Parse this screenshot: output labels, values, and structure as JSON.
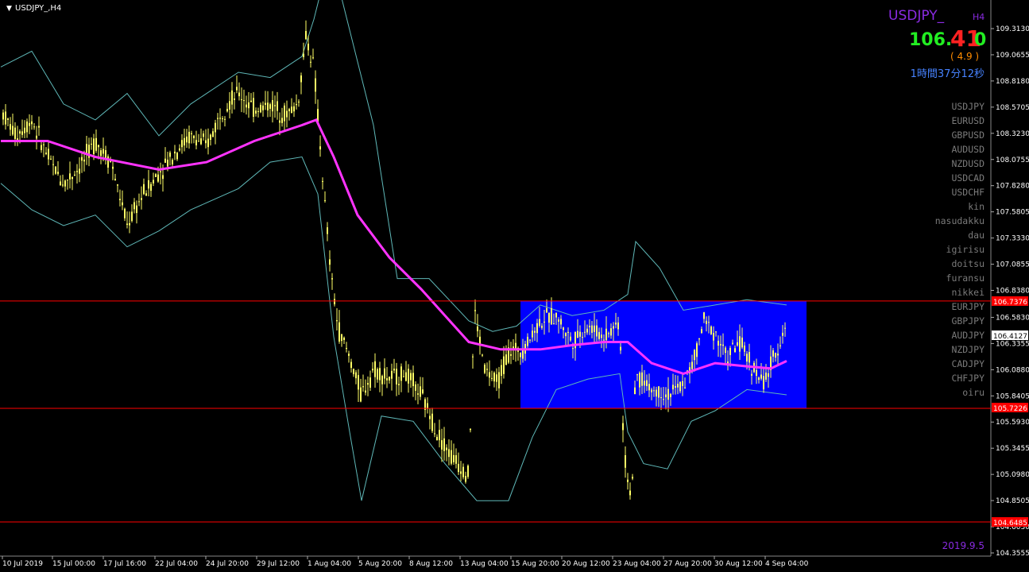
{
  "window": {
    "title": "USDJPY_,H4",
    "menu_glyph": "▼"
  },
  "info": {
    "symbol": "USDJPY_",
    "timeframe": "H4",
    "price_main": "106.",
    "price_big": "41",
    "price_last": "0",
    "spread": "( 4.9 )",
    "countdown": "1時間37分12秒",
    "date": "2019.9.5"
  },
  "symbol_list": [
    "USDJPY",
    "EURUSD",
    "GBPUSD",
    "AUDUSD",
    "NZDUSD",
    "USDCAD",
    "USDCHF",
    "kin",
    "nasudakku",
    "dau",
    "igirisu",
    "doitsu",
    "furansu",
    "nikkei",
    "EURJPY",
    "GBPJPY",
    "AUDJPY",
    "NZDJPY",
    "CADJPY",
    "CHFJPY",
    "oiru"
  ],
  "price_labels": {
    "upper_line": "106.7376",
    "current": "106.4127",
    "lower_line": "105.7226",
    "bottom_line": "104.6485"
  },
  "colors": {
    "background": "#000000",
    "candles": "#ffff66",
    "moving_average": "#ff33ff",
    "bollinger": "#5fb8b8",
    "range_box": "#0000ff",
    "hlines": "#ff0000",
    "symbol_title": "#8a2be2",
    "price_green": "#22ee22",
    "price_red": "#ff2222",
    "spread": "#ff8c00",
    "countdown": "#4682ff",
    "symbol_list": "#7a7a7a",
    "axis_text": "#ffffff"
  },
  "chart_data": {
    "type": "candlestick",
    "y_ticks": [
      "109.3130",
      "109.0655",
      "108.8180",
      "108.5705",
      "108.3230",
      "108.0755",
      "107.8280",
      "107.5805",
      "107.3330",
      "107.0855",
      "106.8380",
      "106.5830",
      "106.3355",
      "106.0880",
      "105.8405",
      "105.5930",
      "105.3455",
      "105.0980",
      "104.8505",
      "104.6030",
      "104.3555"
    ],
    "ylim": [
      104.3555,
      109.313
    ],
    "x_ticks": [
      "10 Jul 2019",
      "15 Jul 00:00",
      "17 Jul 16:00",
      "22 Jul 04:00",
      "24 Jul 20:00",
      "29 Jul 12:00",
      "1 Aug 04:00",
      "5 Aug 20:00",
      "8 Aug 12:00",
      "13 Aug 04:00",
      "15 Aug 20:00",
      "20 Aug 12:00",
      "23 Aug 04:00",
      "27 Aug 20:00",
      "30 Aug 12:00",
      "4 Sep 04:00"
    ],
    "horizontal_lines": [
      106.7376,
      105.7226,
      104.6485
    ],
    "current_price": 106.4127,
    "range_box": {
      "from": "15 Aug 20:00",
      "to": "5 Sep",
      "high": 106.7376,
      "low": 105.7226
    },
    "series": [
      {
        "kind": "price",
        "points": [
          [
            1,
            108.55
          ],
          [
            20,
            108.3
          ],
          [
            40,
            108.45
          ],
          [
            60,
            108.1
          ],
          [
            80,
            107.85
          ],
          [
            100,
            108.0
          ],
          [
            120,
            108.25
          ],
          [
            140,
            108.05
          ],
          [
            160,
            107.45
          ],
          [
            180,
            107.75
          ],
          [
            200,
            107.95
          ],
          [
            220,
            108.15
          ],
          [
            240,
            108.3
          ],
          [
            260,
            108.2
          ],
          [
            280,
            108.55
          ],
          [
            300,
            108.7
          ],
          [
            320,
            108.55
          ],
          [
            340,
            108.6
          ],
          [
            360,
            108.5
          ],
          [
            375,
            108.6
          ],
          [
            385,
            109.25
          ],
          [
            395,
            108.95
          ],
          [
            405,
            108.0
          ],
          [
            415,
            107.1
          ],
          [
            425,
            106.5
          ],
          [
            440,
            106.2
          ],
          [
            455,
            105.85
          ],
          [
            470,
            106.1
          ],
          [
            490,
            106.0
          ],
          [
            510,
            106.05
          ],
          [
            530,
            105.85
          ],
          [
            550,
            105.5
          ],
          [
            570,
            105.25
          ],
          [
            590,
            105.1
          ],
          [
            597,
            106.65
          ],
          [
            610,
            106.1
          ],
          [
            625,
            105.95
          ],
          [
            640,
            106.25
          ],
          [
            660,
            106.3
          ],
          [
            680,
            106.55
          ],
          [
            700,
            106.6
          ],
          [
            720,
            106.35
          ],
          [
            740,
            106.5
          ],
          [
            760,
            106.4
          ],
          [
            780,
            106.55
          ],
          [
            785,
            105.3
          ],
          [
            795,
            104.85
          ],
          [
            800,
            106.05
          ],
          [
            820,
            105.9
          ],
          [
            840,
            105.85
          ],
          [
            860,
            105.95
          ],
          [
            875,
            106.2
          ],
          [
            885,
            106.55
          ],
          [
            900,
            106.45
          ],
          [
            915,
            106.2
          ],
          [
            930,
            106.35
          ],
          [
            945,
            106.15
          ],
          [
            960,
            105.95
          ],
          [
            975,
            106.2
          ],
          [
            990,
            106.55
          ]
        ]
      },
      {
        "kind": "moving_average",
        "points": [
          [
            1,
            108.25
          ],
          [
            60,
            108.25
          ],
          [
            120,
            108.1
          ],
          [
            200,
            107.98
          ],
          [
            260,
            108.05
          ],
          [
            320,
            108.25
          ],
          [
            380,
            108.4
          ],
          [
            398,
            108.45
          ],
          [
            420,
            108.1
          ],
          [
            450,
            107.55
          ],
          [
            490,
            107.15
          ],
          [
            530,
            106.85
          ],
          [
            560,
            106.6
          ],
          [
            590,
            106.35
          ],
          [
            630,
            106.28
          ],
          [
            680,
            106.28
          ],
          [
            720,
            106.32
          ],
          [
            760,
            106.35
          ],
          [
            790,
            106.35
          ],
          [
            820,
            106.15
          ],
          [
            860,
            106.05
          ],
          [
            900,
            106.15
          ],
          [
            940,
            106.12
          ],
          [
            970,
            106.1
          ],
          [
            990,
            106.17
          ]
        ]
      },
      {
        "kind": "bollinger_upper",
        "points": [
          [
            1,
            108.95
          ],
          [
            40,
            109.1
          ],
          [
            80,
            108.6
          ],
          [
            120,
            108.45
          ],
          [
            160,
            108.7
          ],
          [
            200,
            108.3
          ],
          [
            240,
            108.6
          ],
          [
            300,
            108.9
          ],
          [
            340,
            108.85
          ],
          [
            380,
            109.05
          ],
          [
            395,
            109.4
          ],
          [
            405,
            109.7
          ],
          [
            430,
            109.6
          ],
          [
            470,
            108.4
          ],
          [
            500,
            106.95
          ],
          [
            540,
            106.95
          ],
          [
            590,
            106.55
          ],
          [
            620,
            106.45
          ],
          [
            650,
            106.5
          ],
          [
            680,
            106.7
          ],
          [
            720,
            106.6
          ],
          [
            760,
            106.65
          ],
          [
            790,
            106.8
          ],
          [
            800,
            107.3
          ],
          [
            830,
            107.05
          ],
          [
            860,
            106.65
          ],
          [
            900,
            106.7
          ],
          [
            940,
            106.75
          ],
          [
            990,
            106.7
          ]
        ]
      },
      {
        "kind": "bollinger_lower",
        "points": [
          [
            1,
            107.85
          ],
          [
            40,
            107.6
          ],
          [
            80,
            107.45
          ],
          [
            120,
            107.55
          ],
          [
            160,
            107.25
          ],
          [
            200,
            107.4
          ],
          [
            240,
            107.6
          ],
          [
            300,
            107.8
          ],
          [
            340,
            108.05
          ],
          [
            380,
            108.1
          ],
          [
            400,
            107.75
          ],
          [
            420,
            106.4
          ],
          [
            440,
            105.5
          ],
          [
            455,
            104.85
          ],
          [
            480,
            105.65
          ],
          [
            520,
            105.6
          ],
          [
            560,
            105.2
          ],
          [
            600,
            104.85
          ],
          [
            640,
            104.85
          ],
          [
            670,
            105.45
          ],
          [
            700,
            105.9
          ],
          [
            740,
            106.0
          ],
          [
            780,
            106.05
          ],
          [
            790,
            105.5
          ],
          [
            810,
            105.2
          ],
          [
            840,
            105.15
          ],
          [
            870,
            105.6
          ],
          [
            900,
            105.7
          ],
          [
            940,
            105.9
          ],
          [
            990,
            105.85
          ]
        ]
      }
    ]
  }
}
